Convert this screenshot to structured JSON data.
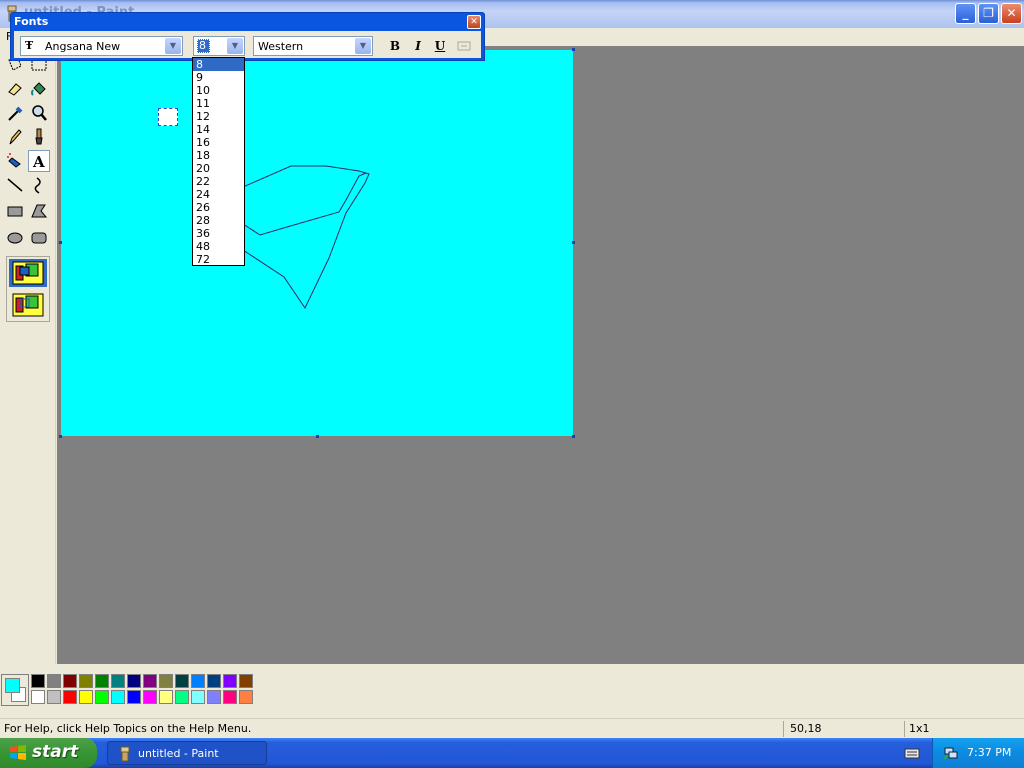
{
  "window": {
    "title": "untitled - Paint"
  },
  "menu": {
    "first_item": "F"
  },
  "fonts_toolbar": {
    "title": "Fonts",
    "font_name": "Angsana New",
    "font_size": "8",
    "script": "Western",
    "bold_label": "B",
    "italic_label": "I",
    "underline_label": "U",
    "size_options": [
      "8",
      "9",
      "10",
      "11",
      "12",
      "14",
      "16",
      "18",
      "20",
      "22",
      "24",
      "26",
      "28",
      "36",
      "48",
      "72"
    ]
  },
  "colors": {
    "foreground": "#00ffff",
    "background": "#ffffff",
    "canvas": "#00ffff",
    "palette_top": [
      "#000000",
      "#808080",
      "#800000",
      "#808000",
      "#008000",
      "#008080",
      "#000080",
      "#800080",
      "#808040",
      "#004040",
      "#0080ff",
      "#004080",
      "#8000ff",
      "#804000"
    ],
    "palette_bottom": [
      "#ffffff",
      "#c0c0c0",
      "#ff0000",
      "#ffff00",
      "#00ff00",
      "#00ffff",
      "#0000ff",
      "#ff00ff",
      "#ffff80",
      "#00ff80",
      "#80ffff",
      "#8080ff",
      "#ff0080",
      "#ff8040"
    ]
  },
  "tools": [
    "free-form-select",
    "select",
    "eraser",
    "fill-with-color",
    "pick-color",
    "magnifier",
    "pencil",
    "brush",
    "airbrush",
    "text",
    "line",
    "curve",
    "rectangle",
    "polygon",
    "ellipse",
    "rounded-rectangle"
  ],
  "status": {
    "help_text": "For Help, click Help Topics on the Help Menu.",
    "cursor_position": "50,18",
    "selection_size": "1x1"
  },
  "taskbar": {
    "start_label": "start",
    "task_label": "untitled - Paint",
    "clock": "7:37 PM"
  }
}
